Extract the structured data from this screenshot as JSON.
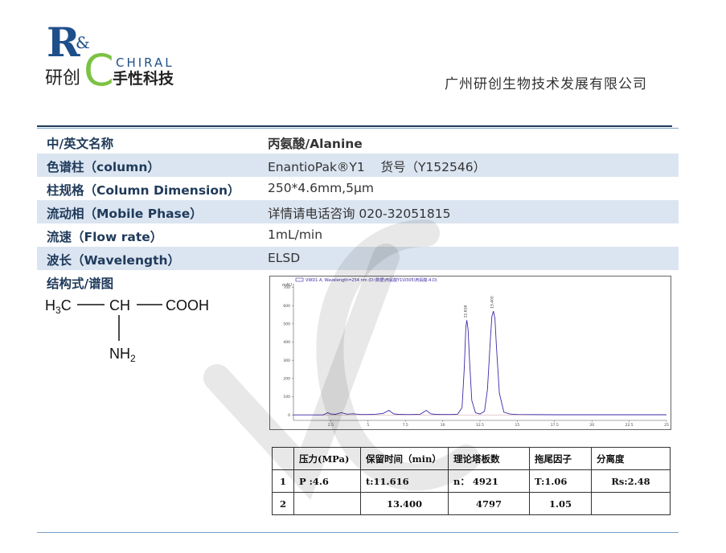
{
  "logo": {
    "letter_r": "R",
    "amp": "&",
    "letter_c": "C",
    "chiral": "CHIRAL",
    "cn_left": "研创",
    "cn_right": "手性科技"
  },
  "company": "广州研创生物技术发展有限公司",
  "rows": [
    {
      "key": "中/英文名称",
      "value": "丙氨酸/Alanine"
    },
    {
      "key": "色谱柱（column）",
      "value": "EnantioPak®Y1    货号（Y152546）"
    },
    {
      "key": "柱规格（Column Dimension）",
      "value": "250*4.6mm,5μm"
    },
    {
      "key": "流动相（Mobile Phase）",
      "value": "详情请电话咨询 020-32051815"
    },
    {
      "key": "流速（Flow rate）",
      "value": "1mL/min"
    },
    {
      "key": "波长（Wavelength）",
      "value": "ELSD"
    }
  ],
  "structure_label": "结构式/谱图",
  "structure": {
    "ch3": "H3C",
    "ch": "CH",
    "cooh": "COOH",
    "nh2": "NH2"
  },
  "chart_data": {
    "type": "line",
    "title": "VWD1 A, Wavelength=254 nm (D:\\数据\\丙氨酸Y1\\0305\\丙氨酸-4.D)",
    "xlabel": "",
    "ylabel": "",
    "ylabel_unit": "mAU",
    "xlim": [
      0,
      25
    ],
    "ylim": [
      -30,
      720
    ],
    "xticks": [
      "2.5",
      "5",
      "7.5",
      "10",
      "12.5",
      "15",
      "17.5",
      "20",
      "22.5",
      "25"
    ],
    "yticks": [
      "0",
      "100",
      "200",
      "300",
      "400",
      "500",
      "600",
      "700"
    ],
    "peak_labels": [
      "11.616",
      "13.400"
    ],
    "series": [
      {
        "x": [
          0,
          1,
          2,
          2.3,
          2.5,
          2.8,
          3.2,
          3.6,
          4.0,
          4.5,
          5.0,
          5.5,
          6.0,
          6.4,
          6.7,
          7.0,
          7.5,
          8.0,
          8.5,
          8.9,
          9.2,
          9.5,
          10.0,
          10.5,
          11.0,
          11.3,
          11.45,
          11.55,
          11.616,
          11.7,
          11.8,
          11.95,
          12.2,
          12.5,
          12.8,
          13.0,
          13.2,
          13.3,
          13.4,
          13.5,
          13.6,
          13.8,
          14.1,
          14.5,
          15.0,
          17.5,
          20.0,
          22.5,
          25.0
        ],
        "y": [
          0,
          0,
          0,
          12,
          5,
          3,
          12,
          4,
          6,
          2,
          2,
          4,
          8,
          25,
          6,
          3,
          2,
          2,
          4,
          25,
          6,
          3,
          2,
          2,
          4,
          40,
          260,
          480,
          520,
          470,
          300,
          80,
          12,
          5,
          20,
          140,
          420,
          540,
          570,
          530,
          380,
          120,
          15,
          5,
          2,
          1,
          1,
          1,
          1
        ]
      }
    ]
  },
  "table": {
    "headers": [
      "",
      "压力(MPa)",
      "保留时间（min）",
      "理论塔板数",
      "拖尾因子",
      "分离度"
    ],
    "rows": [
      [
        "1",
        "P :4.6",
        "t:11.616",
        "n： 4921",
        "T:1.06",
        "Rs:2.48"
      ],
      [
        "2",
        "",
        "13.400",
        "4797",
        "1.05",
        ""
      ]
    ]
  },
  "colors": {
    "brand_blue": "#1f4f8a",
    "brand_green": "#7cc243",
    "row_shade": "#dbe5f1",
    "trace": "#3a2aa8"
  }
}
